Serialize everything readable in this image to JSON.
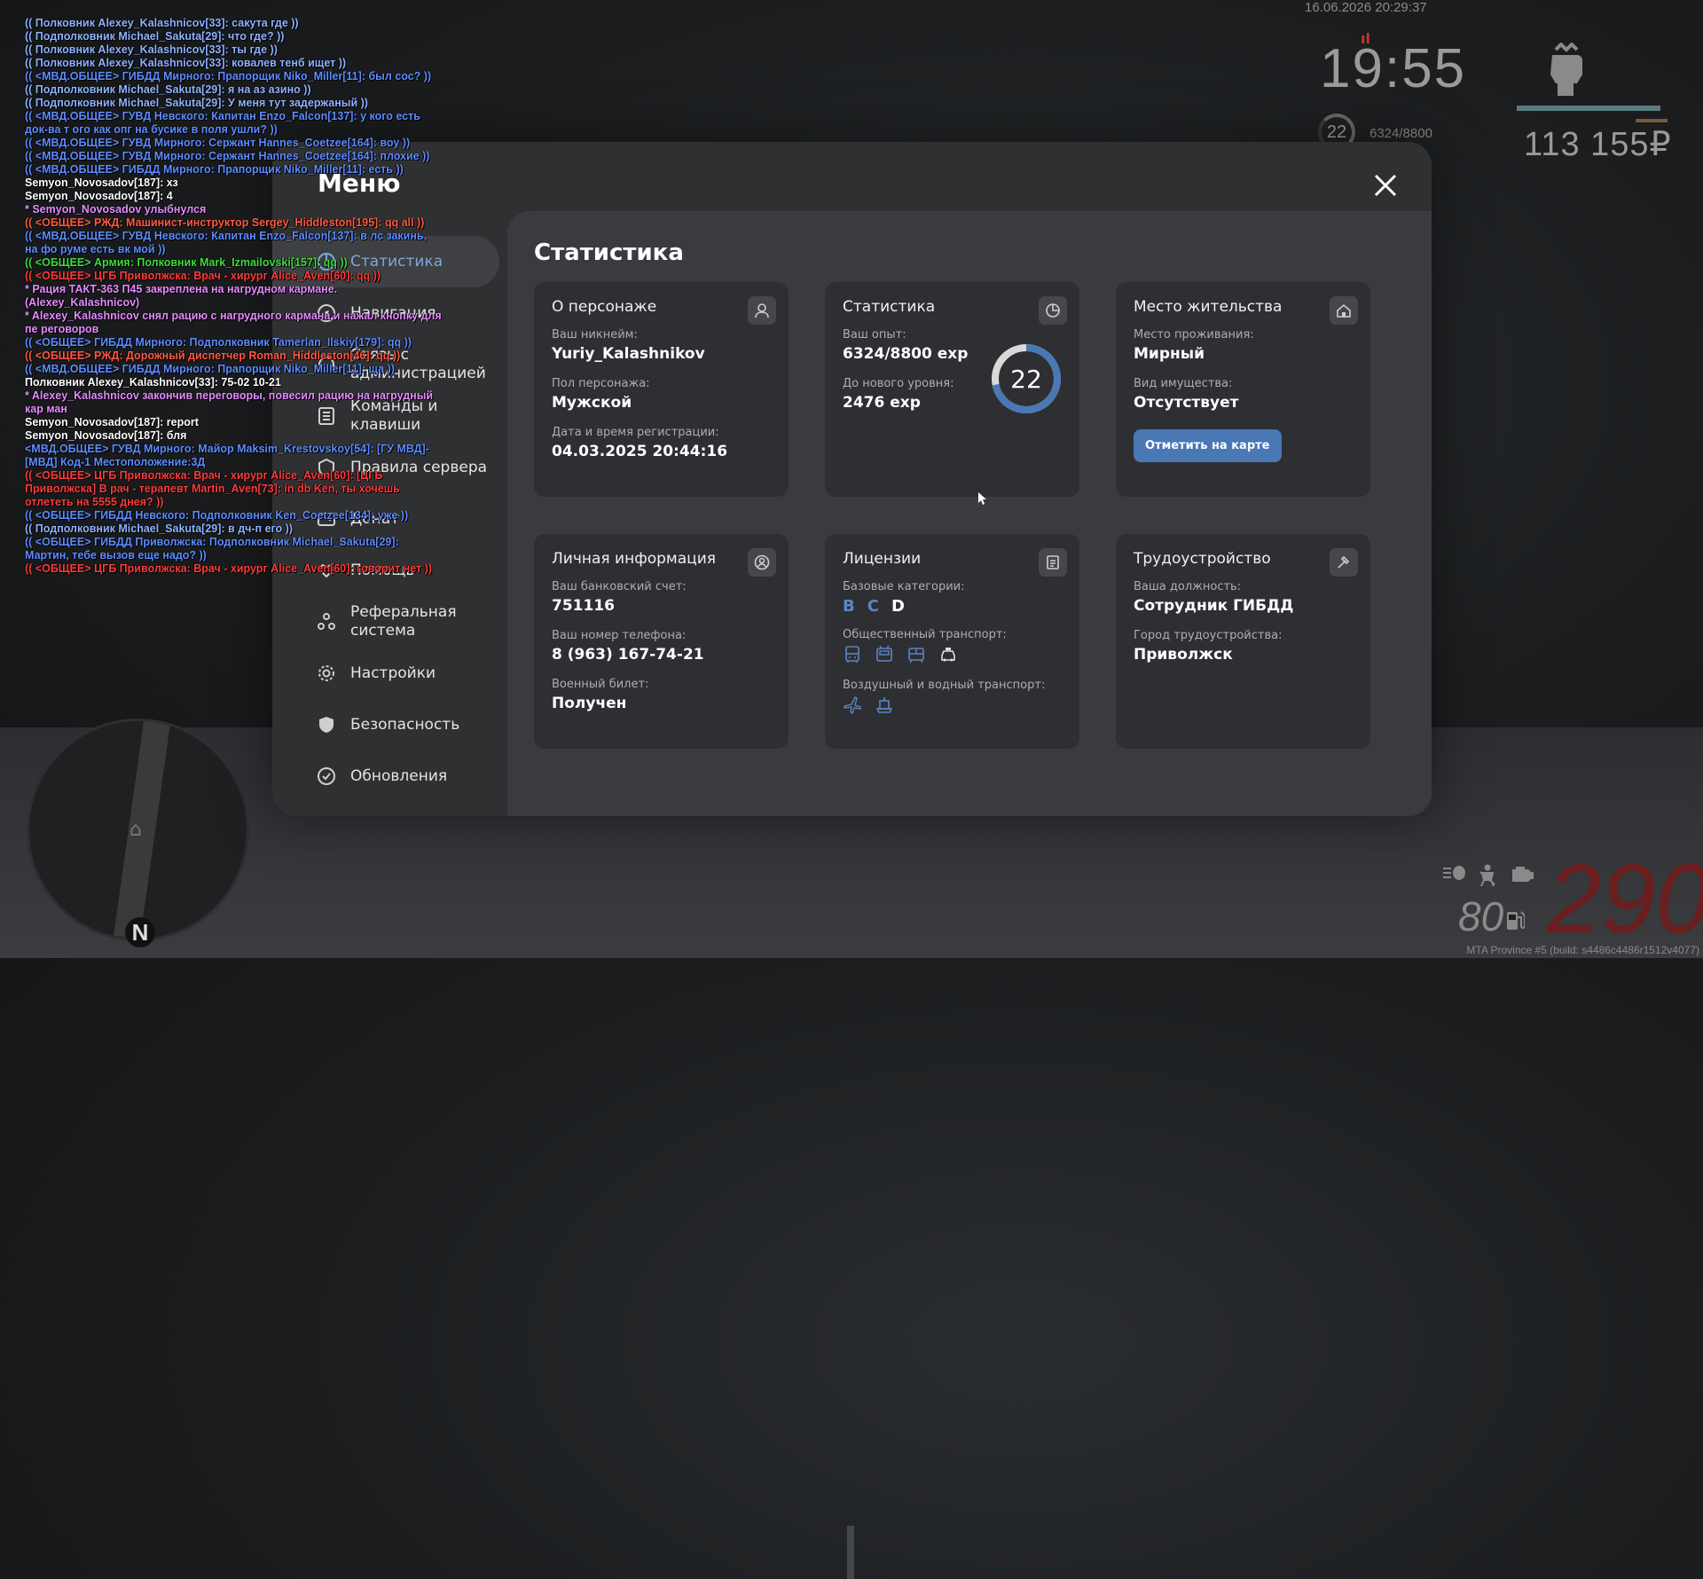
{
  "chat": [
    {
      "text": "(( Полковник Alexey_Kalashnicov[33]: сакута где ))",
      "color": "#8fb3ff"
    },
    {
      "text": "(( Подполковник Michael_Sakuta[29]: что где? ))",
      "color": "#8fb3ff"
    },
    {
      "text": "(( Полковник Alexey_Kalashnicov[33]: ты где ))",
      "color": "#8fb3ff"
    },
    {
      "text": "(( Полковник Alexey_Kalashnicov[33]: ковалев тенб ищет ))",
      "color": "#8fb3ff"
    },
    {
      "text": "(( <МВД.ОБЩЕЕ> ГИБДД Мирного: Прапорщик Niko_Miller[11]: был сос? ))",
      "color": "#5e8cff"
    },
    {
      "text": "(( Подполковник Michael_Sakuta[29]: я на аз азино ))",
      "color": "#8fb3ff"
    },
    {
      "text": "(( Подполковник Michael_Sakuta[29]: У меня тут задержаный ))",
      "color": "#8fb3ff"
    },
    {
      "text": "(( <МВД.ОБЩЕЕ> ГУВД Невского: Капитан Enzo_Falcon[137]: у кого есть док-ва т ого как опг на бусике в поля ушли? ))",
      "color": "#5e8cff"
    },
    {
      "text": "(( <МВД.ОБЩЕЕ> ГУВД Мирного: Сержант Hannes_Coetzee[164]: воу ))",
      "color": "#5e8cff"
    },
    {
      "text": "(( <МВД.ОБЩЕЕ> ГУВД Мирного: Сержант Hannes_Coetzee[164]: плохие ))",
      "color": "#5e8cff"
    },
    {
      "text": "(( <МВД.ОБЩЕЕ> ГИБДД Мирного: Прапорщик Niko_Miller[11]: есть ))",
      "color": "#5e8cff"
    },
    {
      "text": "Semyon_Novosadov[187]: хз",
      "color": "#ffffff"
    },
    {
      "text": "Semyon_Novosadov[187]: 4",
      "color": "#ffffff"
    },
    {
      "text": "* Semyon_Novosadov улыбнулся",
      "color": "#e58cff"
    },
    {
      "text": "(( <ОБЩЕЕ> РЖД: Машинист-инструктор Sergey_Hiddleston[195]: qq all ))",
      "color": "#ff5a45"
    },
    {
      "text": "(( <МВД.ОБЩЕЕ> ГУВД Невского: Капитан Enzo_Falcon[137]: в лс закинь, на фо руме есть вк мой ))",
      "color": "#5e8cff"
    },
    {
      "text": "(( <ОБЩЕЕ> Армия: Полковник Mark_Izmailovski[157]: qq ))",
      "color": "#3fdc3f"
    },
    {
      "text": "(( <ОБЩЕЕ> ЦГБ Приволжска: Врач - хирург Alice_Aven[60]: qq ))",
      "color": "#ff3b3b"
    },
    {
      "text": "* Рация ТАКТ-363 П45 закреплена на нагрудном кармане. (Alexey_Kalashnicov)",
      "color": "#e58cff"
    },
    {
      "text": "* Alexey_Kalashnicov снял рацию с нагрудного кармана и нажал кнопку для пе реговоров",
      "color": "#e58cff"
    },
    {
      "text": "(( <ОБЩЕЕ> ГИБДД Мирного: Подполковник Tamerlan_Ilskiy[179]: qq ))",
      "color": "#5e8cff"
    },
    {
      "text": "(( <ОБЩЕЕ> РЖД: Дорожный диспетчер Roman_Hiddleston[46]: qq ))",
      "color": "#ff5a45"
    },
    {
      "text": "(( <МВД.ОБЩЕЕ> ГИБДД Мирного: Прапорщик Niko_Miller[11]: ща ))",
      "color": "#5e8cff"
    },
    {
      "text": "Полковник Alexey_Kalashnicov[33]: 75-02 10-21",
      "color": "#ffffff"
    },
    {
      "text": "* Alexey_Kalashnicov закончив переговоры, повесил рацию на нагрудный кар ман",
      "color": "#e58cff"
    },
    {
      "text": "Semyon_Novosadov[187]: report",
      "color": "#ffffff"
    },
    {
      "text": "Semyon_Novosadov[187]: бля",
      "color": "#ffffff"
    },
    {
      "text": "<МВД.ОБЩЕЕ> ГУВД Мирного: Майор Maksim_Krestovskoy[54]: [ГУ МВД]-[МВД] Код-1 Местоположение:3Д",
      "color": "#5e8cff"
    },
    {
      "text": "(( <ОБЩЕЕ> ЦГБ Приволжска: Врач - хирург Alice_Aven[60]: [ЦГБ Приволжска] В рач - терапевт Martin_Aven[73]: in db Ken, ты хочешь отлететь на 5555 днея? ))",
      "color": "#ff3b3b"
    },
    {
      "text": "(( <ОБЩЕЕ> ГИБДД Невского: Подполковник Ken_Coetzee[134]: уже ))",
      "color": "#5e8cff"
    },
    {
      "text": "(( Подполковник Michael_Sakuta[29]: в дч-п его ))",
      "color": "#8fb3ff"
    },
    {
      "text": "(( <ОБЩЕЕ> ГИБДД Приволжска: Подполковник Michael_Sakuta[29]: Мартин, тебе вызов еще надо? ))",
      "color": "#5e8cff"
    },
    {
      "text": "(( <ОБЩЕЕ> ЦГБ Приволжска: Врач - хирург Alice_Aven[60]: говорит нет ))",
      "color": "#ff3b3b"
    }
  ],
  "hud": {
    "datetime": "16.06.2026 20:29:37",
    "clock": "19:55",
    "level": "22",
    "exp": "6324/8800",
    "money": "113 155₽",
    "speed": "290",
    "fuel": "80",
    "build": "MTA Province #5 (build: s4486c4486r1512v4077)",
    "health_fraction": 0.95
  },
  "minimap": {
    "north": "N"
  },
  "menu": {
    "title": "Меню",
    "nav": [
      {
        "label": "Статистика",
        "icon": "pie-chart-icon",
        "active": true
      },
      {
        "label": "Навигация",
        "icon": "compass-icon",
        "active": false
      },
      {
        "label": "Связь с администрацией",
        "icon": "headset-icon",
        "active": false
      },
      {
        "label": "Команды и клавиши",
        "icon": "list-icon",
        "active": false
      },
      {
        "label": "Правила сервера",
        "icon": "rules-icon",
        "active": false
      },
      {
        "label": "Донат",
        "icon": "wallet-icon",
        "active": false
      },
      {
        "label": "Помощь",
        "icon": "handshake-icon",
        "active": false
      },
      {
        "label": "Реферальная система",
        "icon": "referral-icon",
        "active": false
      },
      {
        "label": "Настройки",
        "icon": "gear-icon",
        "active": false
      },
      {
        "label": "Безопасность",
        "icon": "shield-icon",
        "active": false
      },
      {
        "label": "Обновления",
        "icon": "update-icon",
        "active": false
      }
    ]
  },
  "stats": {
    "title": "Статистика",
    "character": {
      "title": "О персонаже",
      "nickname_label": "Ваш никнейм:",
      "nickname": "Yuriy_Kalashnikov",
      "gender_label": "Пол персонажа:",
      "gender": "Мужской",
      "registered_label": "Дата и время регистрации:",
      "registered": "04.03.2025 20:44:16"
    },
    "statistics": {
      "title": "Статистика",
      "exp_label": "Ваш опыт:",
      "exp": "6324/8800 exp",
      "next_label": "До нового уровня:",
      "next": "2476 exp",
      "level": "22",
      "progress": 0.7186
    },
    "residence": {
      "title": "Место жительства",
      "place_label": "Место проживания:",
      "place": "Мирный",
      "property_label": "Вид имущества:",
      "property": "Отсутствует",
      "button": "Отметить на карте"
    },
    "personal": {
      "title": "Личная информация",
      "bank_label": "Ваш банковский счет:",
      "bank": "751116",
      "phone_label": "Ваш номер телефона:",
      "phone": "8 (963) 167-74-21",
      "military_label": "Военный билет:",
      "military": "Получен"
    },
    "licenses": {
      "title": "Лицензии",
      "base_label": "Базовые категории:",
      "cat_b": "B",
      "cat_c": "C",
      "cat_d": "D",
      "public_label": "Общественный транспорт:",
      "air_label": "Воздушный и водный транспорт:"
    },
    "employment": {
      "title": "Трудоустройство",
      "position_label": "Ваша должность:",
      "position": "Сотрудник ГИБДД",
      "city_label": "Город трудоустройства:",
      "city": "Приволжск"
    }
  }
}
